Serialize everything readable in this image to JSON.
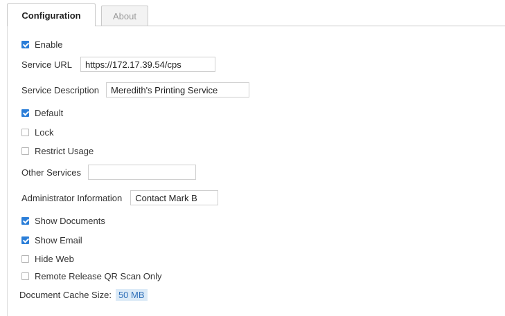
{
  "tabs": {
    "configuration": "Configuration",
    "about": "About"
  },
  "form": {
    "enable": {
      "label": "Enable",
      "checked": true
    },
    "service_url": {
      "label": "Service URL",
      "value": "https://172.17.39.54/cps"
    },
    "service_description": {
      "label": "Service Description",
      "value": "Meredith's Printing Service"
    },
    "default": {
      "label": "Default",
      "checked": true
    },
    "lock": {
      "label": "Lock",
      "checked": false
    },
    "restrict_usage": {
      "label": "Restrict Usage",
      "checked": false
    },
    "other_services": {
      "label": "Other Services",
      "value": ""
    },
    "administrator_information": {
      "label": "Administrator Information",
      "value": "Contact Mark B"
    },
    "show_documents": {
      "label": "Show Documents",
      "checked": true
    },
    "show_email": {
      "label": "Show Email",
      "checked": true
    },
    "hide_web": {
      "label": "Hide Web",
      "checked": false
    },
    "remote_release_qr": {
      "label": "Remote Release QR Scan Only",
      "checked": false
    },
    "document_cache_size": {
      "label": "Document Cache Size:",
      "value": "50 MB"
    }
  },
  "colors": {
    "checkbox_checked": "#2b7ed8",
    "cache_highlight": "#dbeaf7"
  }
}
